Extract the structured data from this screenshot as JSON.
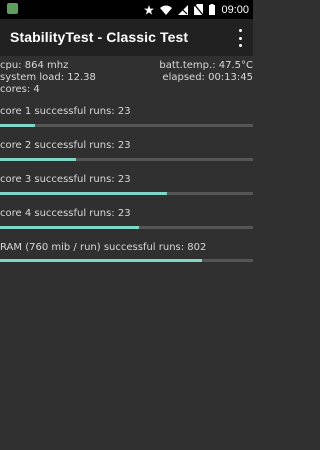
{
  "status_bar": {
    "time": "09:00",
    "icons": [
      "android-notification-icon",
      "star-icon",
      "wifi-icon",
      "signal-no-service-icon",
      "no-sim-icon",
      "battery-icon"
    ]
  },
  "app_bar": {
    "title": "StabilityTest - Classic Test",
    "menu_icon": "overflow-menu-icon"
  },
  "stats": {
    "cpu": "cpu: 864 mhz",
    "batt_temp": "batt.temp.: 47.5°C",
    "system_load": "system load: 12.38",
    "elapsed": "elapsed: 00:13:45",
    "cores": "cores: 4"
  },
  "tests": [
    {
      "label": "core 1 successful runs: 23",
      "progress": 0.14
    },
    {
      "label": "core 2 successful runs: 23",
      "progress": 0.3
    },
    {
      "label": "core 3 successful runs: 23",
      "progress": 0.66
    },
    {
      "label": "core 4 successful runs: 23",
      "progress": 0.55
    },
    {
      "label": "RAM (760 mib / run) successful runs: 802",
      "progress": 0.8
    }
  ],
  "colors": {
    "background": "#303030",
    "app_bar": "#212121",
    "progress_fill": "#7fd8c7",
    "progress_track": "#555555"
  }
}
